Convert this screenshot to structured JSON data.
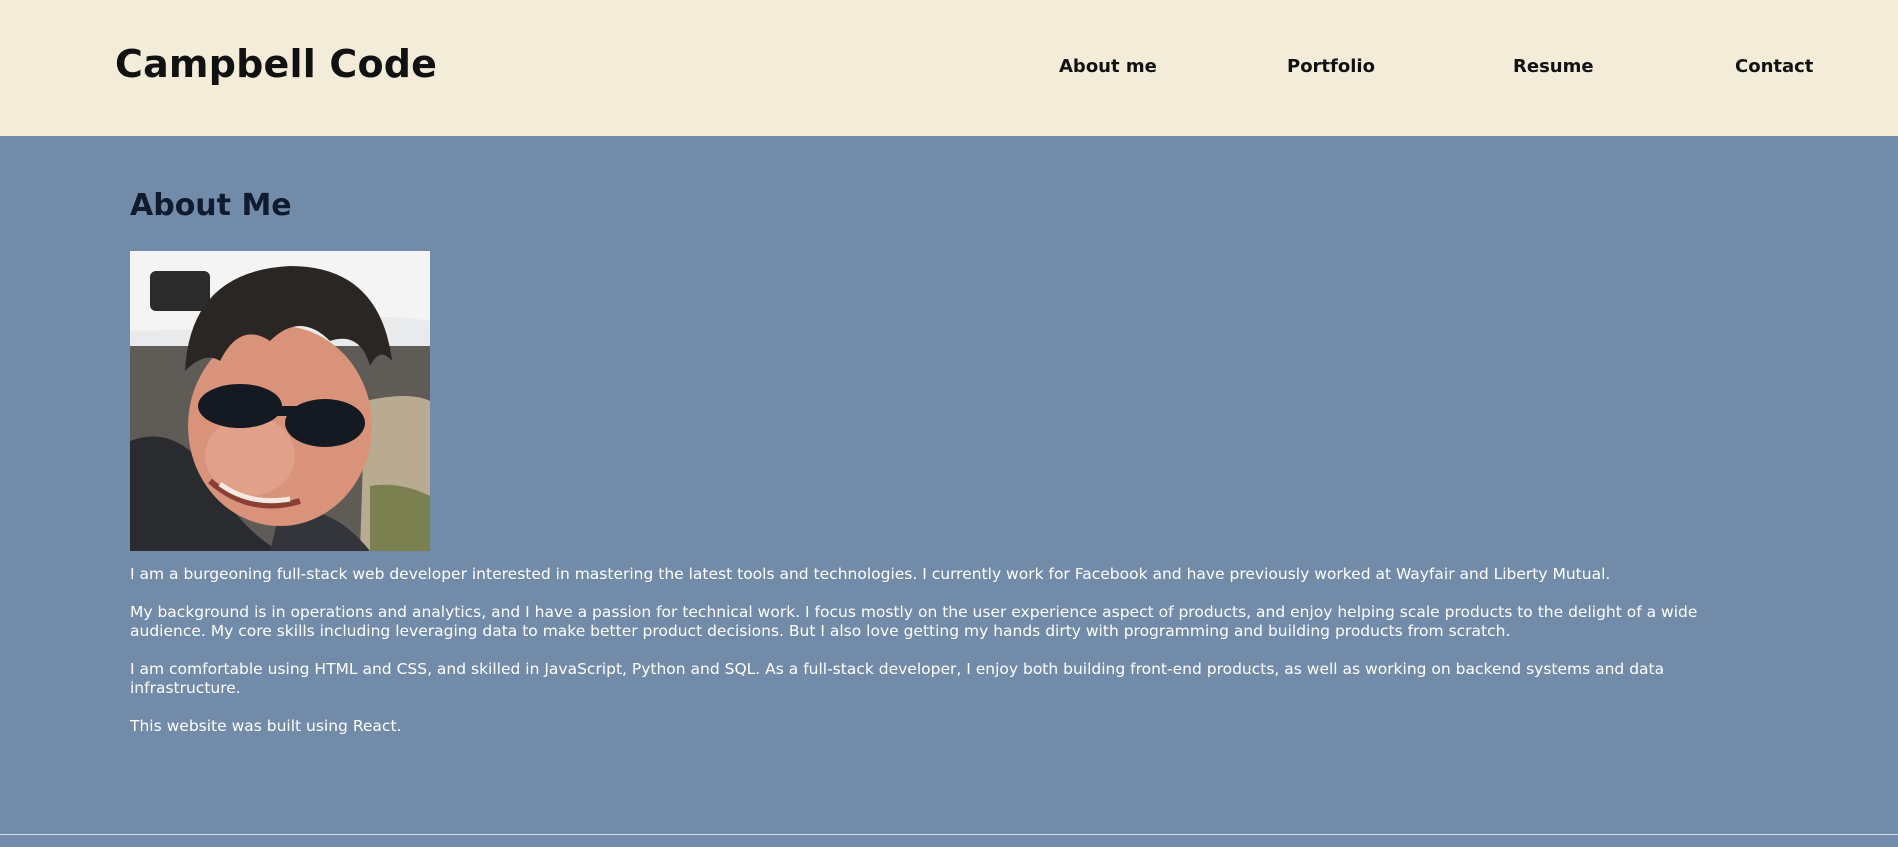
{
  "header": {
    "brand": "Campbell Code",
    "nav": [
      {
        "label": "About me"
      },
      {
        "label": "Portfolio"
      },
      {
        "label": "Resume"
      },
      {
        "label": "Contact"
      }
    ]
  },
  "about": {
    "title": "About Me",
    "photo_alt": "Portrait photo",
    "paragraphs": [
      "I am a burgeoning full-stack web developer interested in mastering the latest tools and technologies. I currently work for Facebook and have previously worked at Wayfair and Liberty Mutual.",
      "My background is in operations and analytics, and I have a passion for technical work. I focus mostly on the user experience aspect of products, and enjoy helping scale products to the delight of a wide audience. My core skills including leveraging data to make better product decisions. But I also love getting my hands dirty with programming and building products from scratch.",
      "I am comfortable using HTML and CSS, and skilled in JavaScript, Python and SQL. As a full-stack developer, I enjoy both building front-end products, as well as working on backend systems and data infrastructure.",
      "This website was built using React."
    ]
  },
  "colors": {
    "header_bg": "#f2ecd9",
    "page_bg": "#728ba9",
    "text_dark": "#111111",
    "text_light": "#ffffff"
  }
}
